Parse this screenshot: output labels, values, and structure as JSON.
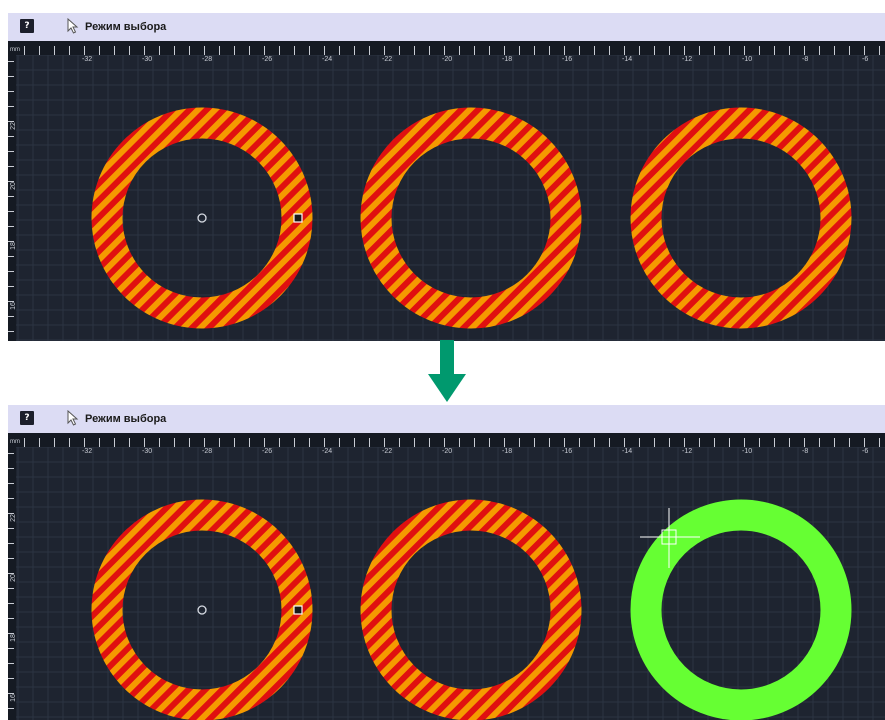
{
  "toolbar": {
    "help_label": "?",
    "mode_label": "Режим выбора",
    "cursor_icon": "cursor-arrow-icon"
  },
  "ruler": {
    "unit": "mm",
    "x_ticks": [
      "-32",
      "-30",
      "-28",
      "-26",
      "-24",
      "-22",
      "-20",
      "-18",
      "-16",
      "-14",
      "-12",
      "-10",
      "-8",
      "-6"
    ],
    "y_ticks": [
      "22",
      "20",
      "18",
      "16"
    ]
  },
  "colors": {
    "canvas_bg": "#1e2430",
    "grid": "#2c3442",
    "ruler_bg": "#151a23",
    "hatch_red": "#e01010",
    "hatch_orange": "#f59a00",
    "selected_green": "#66ff33",
    "arrow": "#00996e"
  },
  "panels": [
    {
      "name": "before",
      "rings": [
        {
          "state": "hatched"
        },
        {
          "state": "hatched"
        },
        {
          "state": "hatched"
        }
      ]
    },
    {
      "name": "after",
      "rings": [
        {
          "state": "hatched"
        },
        {
          "state": "hatched"
        },
        {
          "state": "selected"
        }
      ]
    }
  ],
  "transition_icon": "arrow-down-icon"
}
